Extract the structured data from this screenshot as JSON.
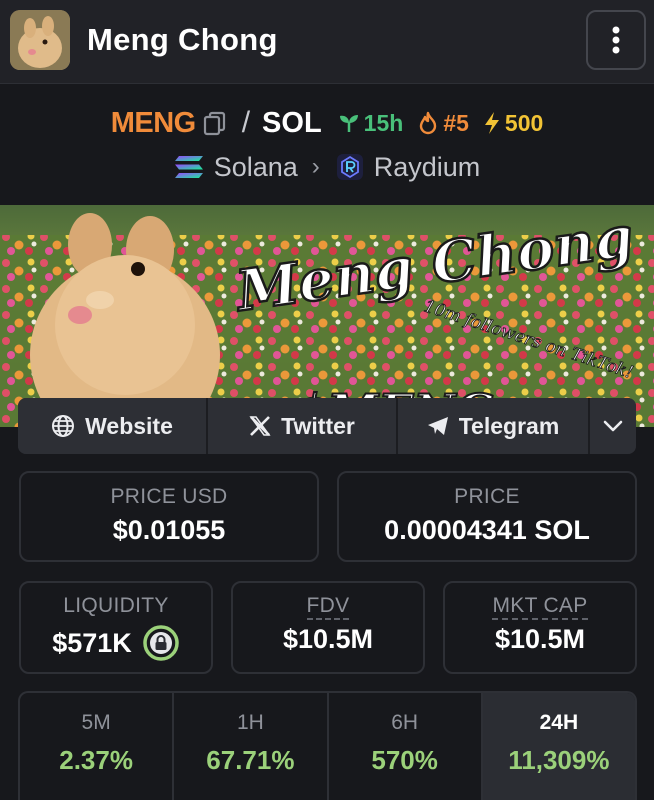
{
  "header": {
    "title": "Meng Chong"
  },
  "pair": {
    "base": "MENG",
    "separator": "/",
    "quote": "SOL",
    "age": "15h",
    "rank": "#5",
    "boost": "500",
    "chain": "Solana",
    "dex": "Raydium"
  },
  "banner": {
    "headline": "Meng Chong",
    "tagline": "10m followers on TikTok!",
    "ticker": "$MENG"
  },
  "links": {
    "website": "Website",
    "twitter": "Twitter",
    "telegram": "Telegram"
  },
  "stats": {
    "price_usd_label": "PRICE USD",
    "price_usd": "$0.01055",
    "price_label": "PRICE",
    "price": "0.00004341 SOL",
    "liquidity_label": "LIQUIDITY",
    "liquidity": "$571K",
    "fdv_label": "FDV",
    "fdv": "$10.5M",
    "mktcap_label": "MKT CAP",
    "mktcap": "$10.5M"
  },
  "timeframes": [
    {
      "label": "5M",
      "change": "2.37%"
    },
    {
      "label": "1H",
      "change": "67.71%"
    },
    {
      "label": "6H",
      "change": "570%"
    },
    {
      "label": "24H",
      "change": "11,309%"
    }
  ],
  "colors": {
    "base_token": "#f08b3a",
    "age": "#49c07a",
    "boost": "#f2c335",
    "positive": "#9bd17a"
  }
}
